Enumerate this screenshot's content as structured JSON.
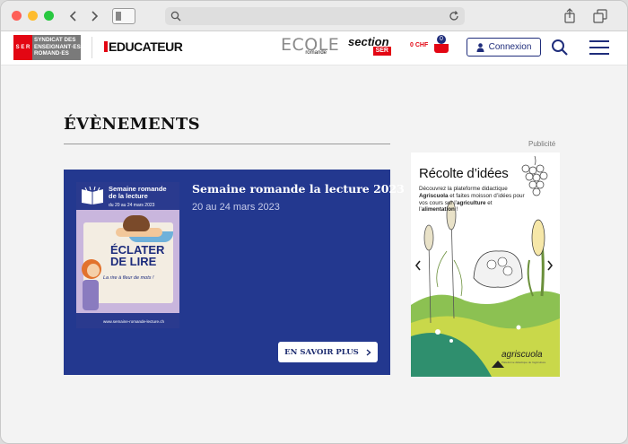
{
  "header": {
    "ser_abbr": "S E R",
    "ser_name": "SYNDICAT DES ENSEIGNANT·ES ROMAND·ES",
    "educateur": "EDUCATEUR",
    "ecole_word": "ECOLE",
    "ecole_sub": "romande",
    "section_word": "section",
    "section_tag": "SER",
    "cart_amount": "0 CHF",
    "cart_count": "0",
    "login_label": "Connexion"
  },
  "main": {
    "page_title": "ÉVÈNEMENTS",
    "ad_label": "Publicité",
    "event": {
      "title": "Semaine romande la lecture 2023",
      "date": "20 au 24 mars 2023",
      "cta": "EN SAVOIR PLUS",
      "poster": {
        "title": "Semaine romande de la lecture",
        "date": "du 20 au 24 mars 2023",
        "headline": "ÉCLATER DE LIRE",
        "tagline": "La rire à fleur de mots !",
        "url": "www.semaine-romande-lecture.ch"
      }
    },
    "ad": {
      "headline": "Récolte d’idées",
      "body_1": "Découvrez la plateforme didactique ",
      "body_brand": "Agriscuola",
      "body_2": " et faites moisson d’idées pour vos cours sur l’",
      "body_kw1": "agriculture",
      "body_3": " et l’",
      "body_kw2": "alimentation",
      "body_4": " !",
      "logo": "agriscuola",
      "logo_sub": "Plateforme didactique de l'agriculture"
    }
  },
  "colors": {
    "brand_red": "#e30613",
    "brand_navy": "#1f2d7b",
    "card_bg": "#23388f"
  }
}
